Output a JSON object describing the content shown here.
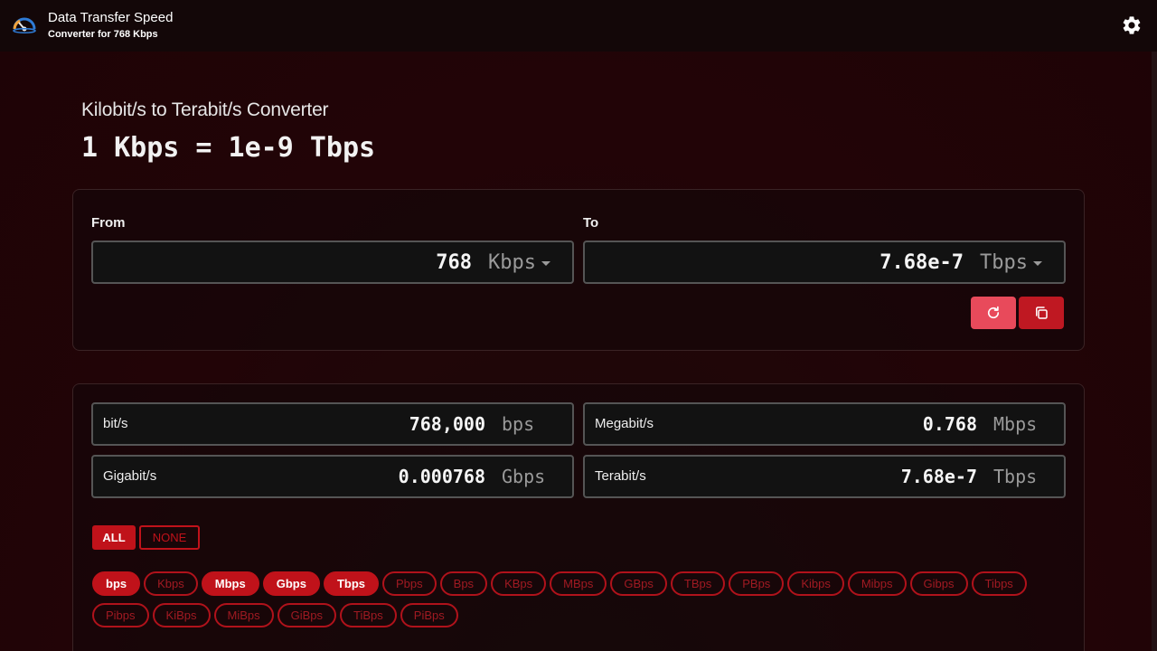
{
  "app": {
    "title": "Data Transfer Speed",
    "subtitle": "Converter for 768 Kbps"
  },
  "icons": {
    "logo": "speedometer-logo-icon",
    "settings": "gear-icon",
    "reset": "refresh-icon",
    "copy": "copy-icon",
    "dropdown": "chevron-down-icon"
  },
  "heading": "Kilobit/s to Terabit/s Converter",
  "formula": "1 Kbps = 1e-9 Tbps",
  "converter": {
    "from": {
      "label": "From",
      "value": "768",
      "unit": "Kbps"
    },
    "to": {
      "label": "To",
      "value": "7.68e-7",
      "unit": "Tbps"
    }
  },
  "results": [
    {
      "name": "bit/s",
      "value": "768,000",
      "unit": "bps"
    },
    {
      "name": "Megabit/s",
      "value": "0.768",
      "unit": "Mbps"
    },
    {
      "name": "Gigabit/s",
      "value": "0.000768",
      "unit": "Gbps"
    },
    {
      "name": "Terabit/s",
      "value": "7.68e-7",
      "unit": "Tbps"
    }
  ],
  "filters": {
    "all": "ALL",
    "none": "NONE"
  },
  "units_row1": [
    {
      "label": "bps",
      "on": true
    },
    {
      "label": "Kbps",
      "on": false
    },
    {
      "label": "Mbps",
      "on": true
    },
    {
      "label": "Gbps",
      "on": true
    },
    {
      "label": "Tbps",
      "on": true
    },
    {
      "label": "Pbps",
      "on": false
    },
    {
      "label": "Bps",
      "on": false
    },
    {
      "label": "KBps",
      "on": false
    },
    {
      "label": "MBps",
      "on": false
    },
    {
      "label": "GBps",
      "on": false
    },
    {
      "label": "TBps",
      "on": false
    },
    {
      "label": "PBps",
      "on": false
    },
    {
      "label": "Kibps",
      "on": false
    },
    {
      "label": "Mibps",
      "on": false
    },
    {
      "label": "Gibps",
      "on": false
    },
    {
      "label": "Tibps",
      "on": false
    }
  ],
  "units_row2": [
    {
      "label": "Pibps",
      "on": false
    },
    {
      "label": "KiBps",
      "on": false
    },
    {
      "label": "MiBps",
      "on": false
    },
    {
      "label": "GiBps",
      "on": false
    },
    {
      "label": "TiBps",
      "on": false
    },
    {
      "label": "PiBps",
      "on": false
    }
  ],
  "colors": {
    "accent": "#c0121a",
    "accent_light": "#e84a5b",
    "background": "#200407",
    "header": "#130708"
  }
}
